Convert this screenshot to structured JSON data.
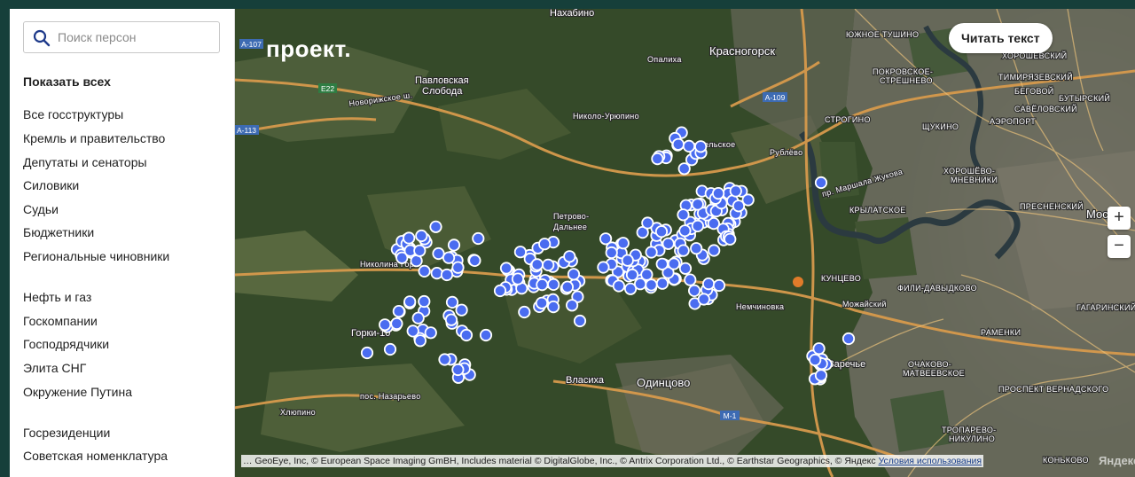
{
  "sidebar": {
    "search": {
      "placeholder": "Поиск персон",
      "value": ""
    },
    "show_all": "Показать всех",
    "groups": [
      [
        "Все госструктуры",
        "Кремль и правительство",
        "Депутаты и сенаторы",
        "Силовики",
        "Судьи",
        "Бюджетники",
        "Региональные чиновники"
      ],
      [
        "Нефть и газ",
        "Госкомпании",
        "Господрядчики",
        "Элита СНГ",
        "Окружение Путина"
      ],
      [
        "Госрезиденции",
        "Советская номенклатура"
      ]
    ]
  },
  "map": {
    "logo": "проект.",
    "read_button": "Читать текст",
    "zoom_in": "+",
    "zoom_out": "−",
    "attribution": "… GeoEye, Inc, © European Space Imaging GmBH, Includes material © DigitalGlobe, Inc., © Antrix Corporation Ltd., © Earthstar Geographics, © Яндекс",
    "terms_link": "Условия использования",
    "provider": "Яндекс",
    "road_shields": [
      "A-107",
      "E22",
      "A-113",
      "A-109",
      "M-1"
    ],
    "places": {
      "nakhabino": "Нахабино",
      "krasnogorsk": "Красногорск",
      "opalikha": "Опалиха",
      "pavlovskaya_sloboda": "Павловская Слобода",
      "nikolo_uryupino": "Николо-Урюпино",
      "arkhangelskoe": "Архангельское",
      "rublevo": "Рублёво",
      "petrovo_dalnee": "Петрово-Дальнее",
      "nikolina_gora": "Николина Гора",
      "gorki_10": "Горки-10",
      "vlasikha": "Власиха",
      "odintsovo": "Одинцово",
      "nemchinovka": "Немчиновка",
      "pos_nazaryevo": "пос. Назарьево",
      "khlupino": "Хлюпино",
      "mozhayskiy": "Можайский",
      "kuntsevo": "КУНЦЕВО",
      "krylatskoe": "КРЫЛАТСКОЕ",
      "fili_davydkovo": "ФИЛИ-ДАВЫДКОВО",
      "ochakovo_matveevskoe": "ОЧАКОВО-МАТВЕЕВСКОЕ",
      "troparevo_nikulino": "ТРОПАРЕВО-НИКУЛИНО",
      "presnensky": "ПРЕСНЕНСКИЙ",
      "khoroshevo_mnevniki": "ХОРОШЁВО-МНЕВНИКИ",
      "strogino": "СТРОГИНО",
      "shchukino": "ЩУКИНО",
      "yuzhnoe_tushino": "ЮЖНОЕ ТУШИНО",
      "pokrovskoe_streshnevo": "ПОКРОВСКОЕ-СТРЕШНЕВО",
      "khoroshevsky": "ХОРОШЁВСКИЙ",
      "begovoy": "БЕГОВОЙ",
      "airport": "АЭРОПОРТ",
      "timiryazevsky": "ТИМИРЯЗЕВСКИЙ",
      "savyolovsky": "САВЁЛОВСКИЙ",
      "butyrsky": "БУТЫРСКИЙ",
      "moskva": "Моск",
      "ramenki": "РАМЕНКИ",
      "prospekt_vernadskogo": "ПРОСПЕКТ ВЕРНАДСКОГО",
      "gagarinsky": "ГАГАРИНСКИЙ",
      "konkovo": "КОНЬКОВО",
      "zarechye": "Заречье",
      "marshala_zhukova": "пр. Маршала Жукова",
      "novorizhskoe": "Новорижское ш."
    }
  }
}
